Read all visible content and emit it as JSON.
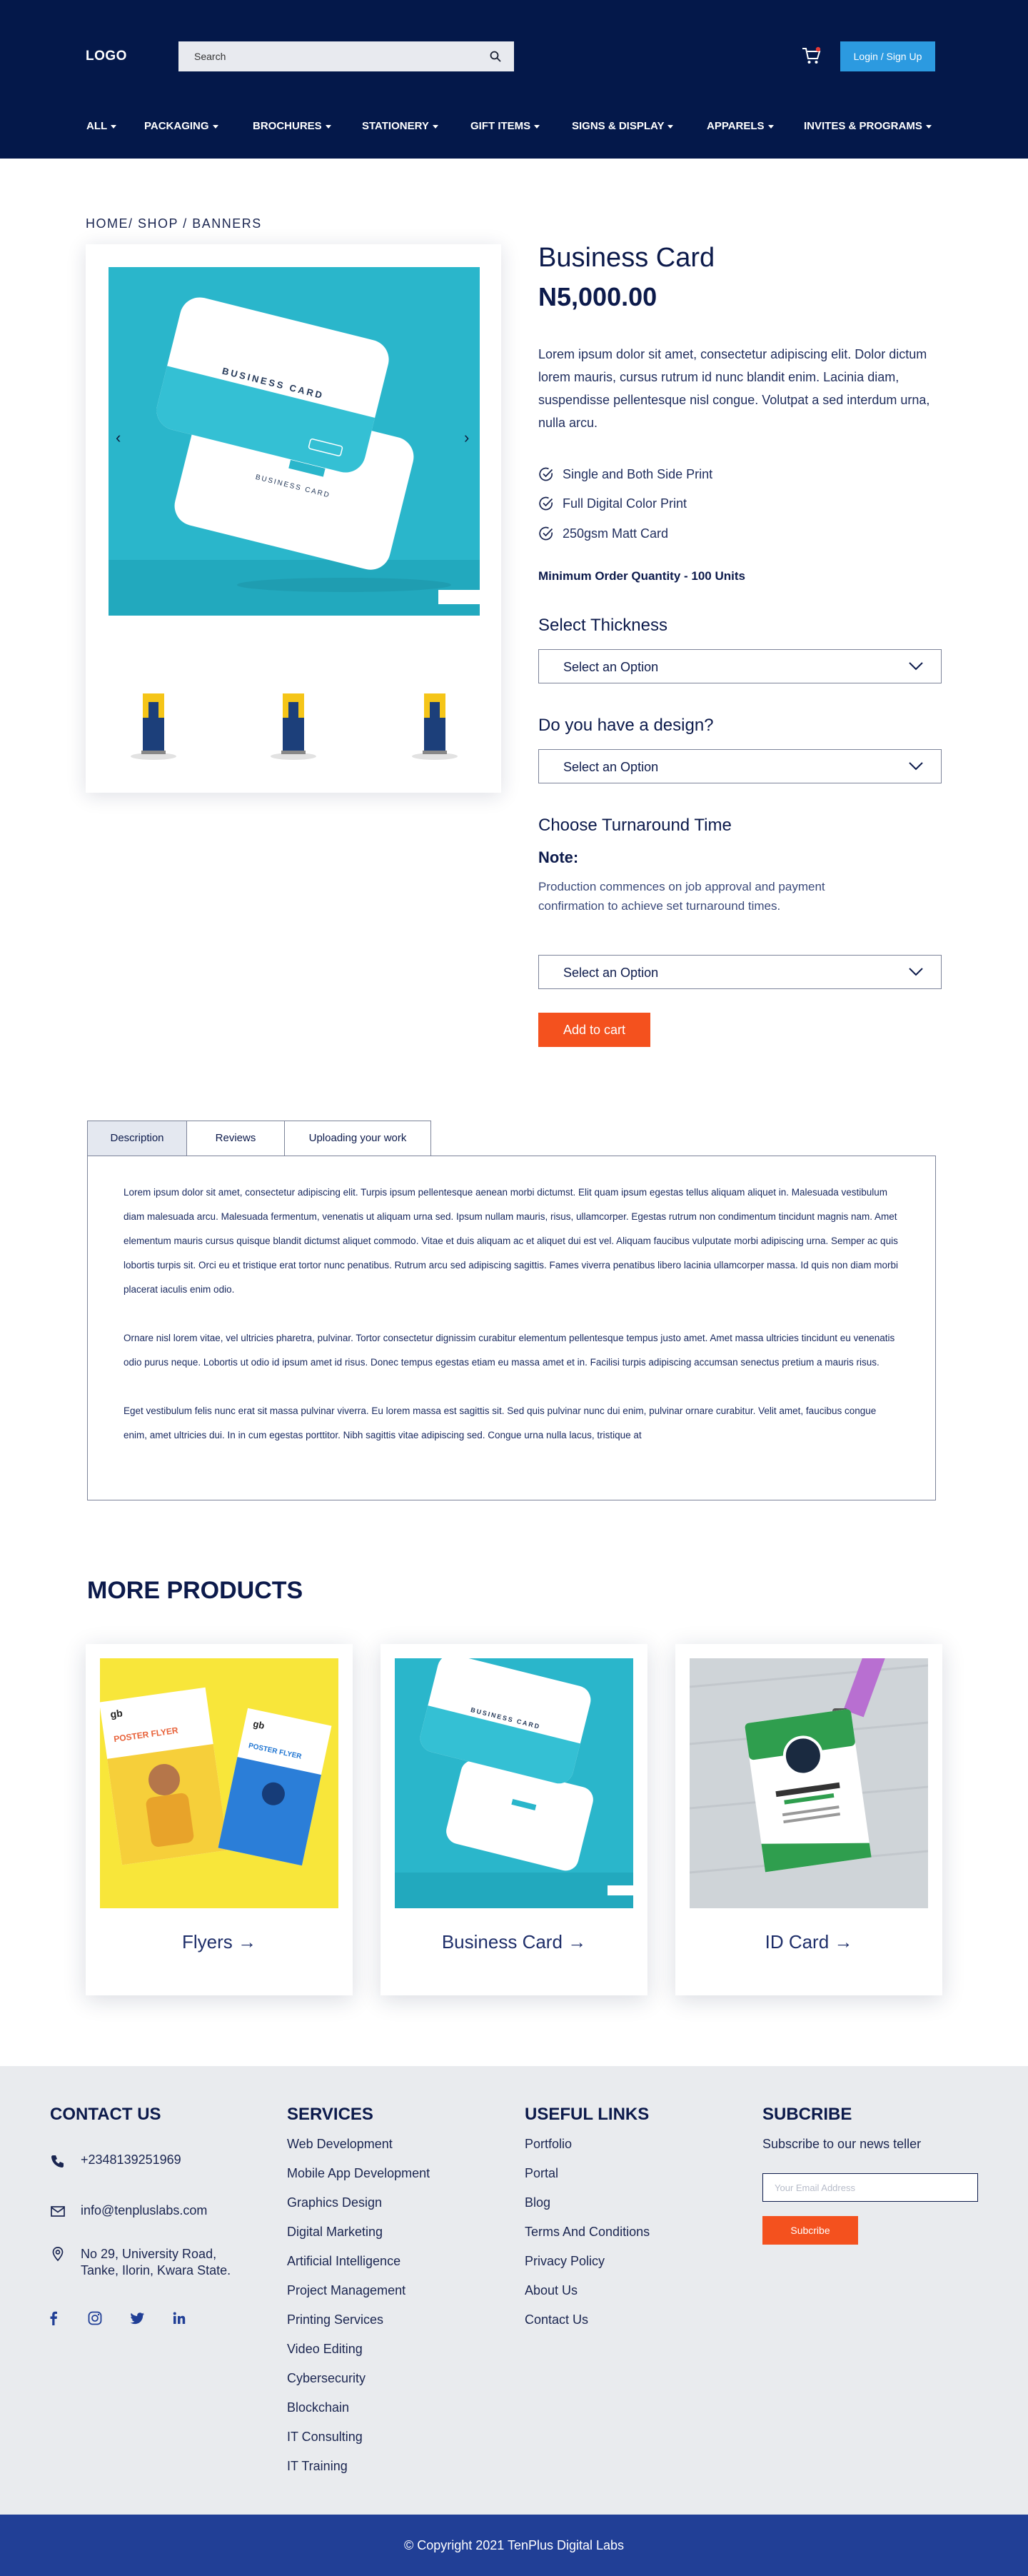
{
  "header": {
    "logo": "LOGO",
    "search_placeholder": "Search",
    "login_label": "Login / Sign Up",
    "nav": [
      "ALL",
      "PACKAGING",
      "BROCHURES",
      "STATIONERY",
      "GIFT ITEMS",
      "SIGNS & DISPLAY",
      "APPARELS",
      "INVITES & PROGRAMS"
    ]
  },
  "breadcrumb": "HOME/ SHOP / BANNERS",
  "product": {
    "title": "Business Card",
    "price": "N5,000.00",
    "description": "Lorem ipsum dolor sit amet, consectetur adipiscing elit. Dolor dictum lorem mauris, cursus rutrum id nunc blandit enim. Lacinia diam, suspendisse pellentesque nisl congue. Volutpat a sed interdum urna, nulla arcu.",
    "features": [
      "Single and Both Side Print",
      "Full Digital Color Print",
      "250gsm Matt Card"
    ],
    "moq": "Minimum Order Quantity - 100 Units",
    "thickness_heading": "Select Thickness",
    "thickness_value": "Select an Option",
    "design_heading": "Do you have a design?",
    "design_value": "Select an Option",
    "turnaround_heading": "Choose Turnaround Time",
    "note_heading": "Note:",
    "note_text": "Production commences on job approval and payment confirmation to achieve set turnaround times.",
    "turnaround_value": "Select an Option",
    "add_to_cart": "Add to cart",
    "mockup_text": "BUSINESS CARD"
  },
  "tabs": {
    "labels": [
      "Description",
      "Reviews",
      "Uploading your work"
    ],
    "paragraphs": [
      "Lorem ipsum dolor sit amet, consectetur adipiscing elit. Turpis ipsum pellentesque aenean morbi dictumst. Elit quam ipsum egestas tellus aliquam aliquet in. Malesuada vestibulum diam malesuada arcu. Malesuada fermentum, venenatis ut aliquam urna sed. Ipsum nullam mauris, risus, ullamcorper. Egestas rutrum non condimentum tincidunt magnis nam. Amet elementum mauris cursus quisque blandit dictumst aliquet commodo. Vitae et duis aliquam ac et aliquet dui est vel. Aliquam faucibus vulputate morbi adipiscing urna. Semper ac quis lobortis turpis sit. Orci eu et tristique erat tortor nunc penatibus. Rutrum arcu sed adipiscing sagittis. Fames viverra penatibus libero lacinia ullamcorper massa. Id quis non diam morbi placerat iaculis enim odio.",
      "Ornare nisl lorem vitae, vel ultricies pharetra, pulvinar. Tortor consectetur dignissim curabitur elementum pellentesque tempus justo amet. Amet massa ultricies tincidunt eu venenatis odio purus neque. Lobortis ut odio id ipsum amet id risus. Donec tempus egestas etiam eu massa amet et in. Facilisi turpis adipiscing accumsan senectus pretium a mauris risus.",
      "Eget vestibulum felis nunc erat sit massa pulvinar viverra. Eu lorem massa est sagittis sit. Sed quis pulvinar nunc dui enim, pulvinar ornare curabitur. Velit amet, faucibus congue enim, amet ultricies dui. In in cum egestas porttitor. Nibh sagittis vitae adipiscing sed. Congue urna nulla lacus, tristique at"
    ]
  },
  "more": {
    "heading": "MORE PRODUCTS",
    "items": [
      "Flyers →",
      "Business Card →",
      "ID Card →"
    ],
    "flyer_brand": "gb",
    "flyer_title": "POSTER FLYER"
  },
  "footer": {
    "contact_heading": "CONTACT US",
    "phone": "+2348139251969",
    "email": "info@tenpluslabs.com",
    "address_line1": "No 29, University Road,",
    "address_line2": "Tanke, Ilorin, Kwara State.",
    "services_heading": "SERVICES",
    "services": [
      "Web Development",
      "Mobile App Development",
      "Graphics Design",
      "Digital Marketing",
      "Artificial Intelligence",
      "Project Management",
      "Printing Services",
      "Video Editing",
      "Cybersecurity",
      "Blockchain",
      "IT Consulting",
      "IT Training"
    ],
    "links_heading": "USEFUL LINKS",
    "links": [
      "Portfolio",
      "Portal",
      "Blog",
      "Terms And Conditions",
      "Privacy Policy",
      "About Us",
      "Contact Us"
    ],
    "subscribe_heading": "SUBCRIBE",
    "subscribe_text": "Subscribe to our news teller",
    "email_placeholder": "Your Email Address",
    "subscribe_button": "Subcribe",
    "copyright": "© Copyright 2021 TenPlus Digital Labs"
  }
}
